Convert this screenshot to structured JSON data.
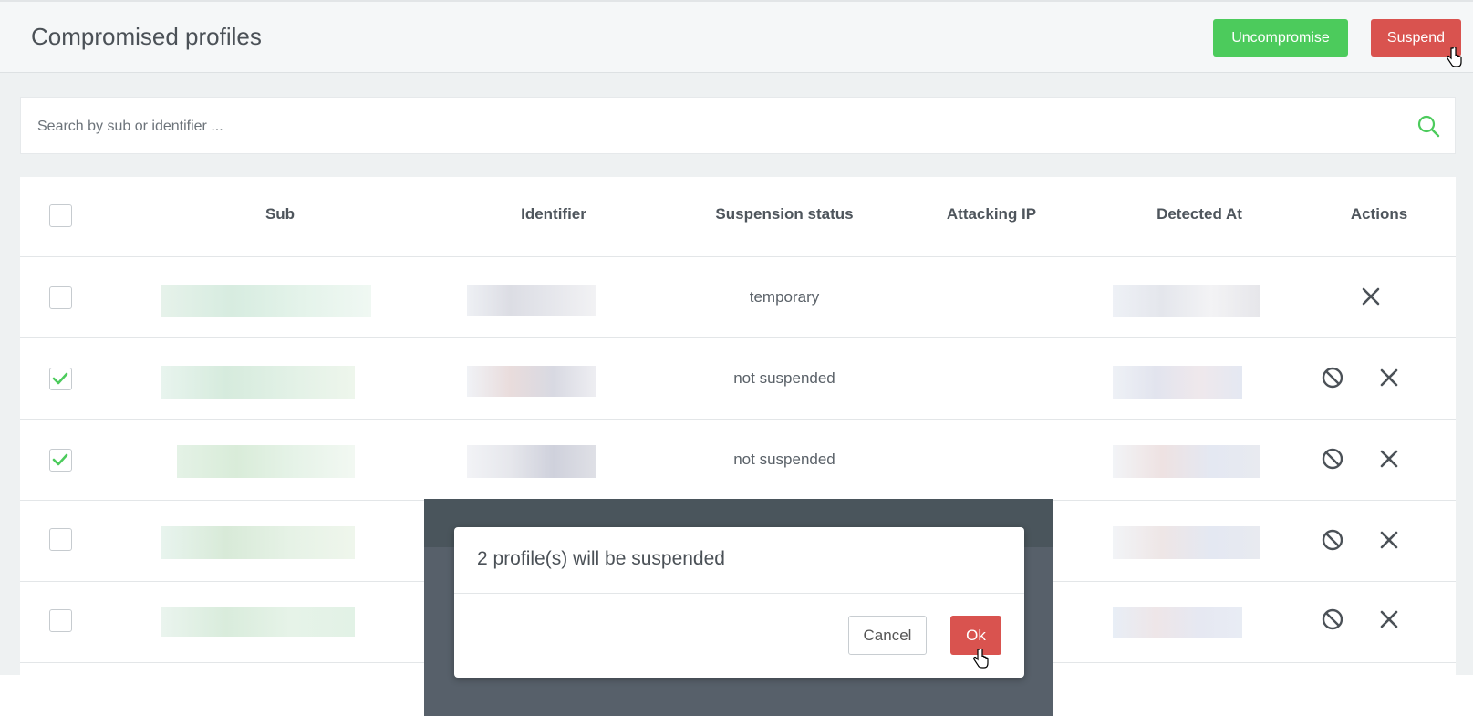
{
  "header": {
    "title": "Compromised profiles",
    "uncompromise_label": "Uncompromise",
    "suspend_label": "Suspend"
  },
  "search": {
    "placeholder": "Search by sub or identifier ..."
  },
  "table": {
    "columns": [
      "Sub",
      "Identifier",
      "Suspension status",
      "Attacking IP",
      "Detected At",
      "Actions"
    ],
    "rows": [
      {
        "checked": false,
        "status": "temporary",
        "actions": [
          "remove"
        ]
      },
      {
        "checked": true,
        "status": "not suspended",
        "actions": [
          "suspend",
          "remove"
        ]
      },
      {
        "checked": true,
        "status": "not suspended",
        "actions": [
          "suspend",
          "remove"
        ]
      },
      {
        "checked": false,
        "status": "",
        "actions": [
          "suspend",
          "remove"
        ]
      },
      {
        "checked": false,
        "status": "",
        "actions": [
          "suspend",
          "remove"
        ]
      }
    ]
  },
  "modal": {
    "message": "2 profile(s) will be suspended",
    "cancel_label": "Cancel",
    "ok_label": "Ok"
  },
  "colors": {
    "accent_green": "#4ccb5c",
    "danger_red": "#d9534f"
  },
  "icons": [
    "search-icon",
    "check-icon",
    "ban-icon",
    "close-icon",
    "hand-cursor-icon"
  ]
}
